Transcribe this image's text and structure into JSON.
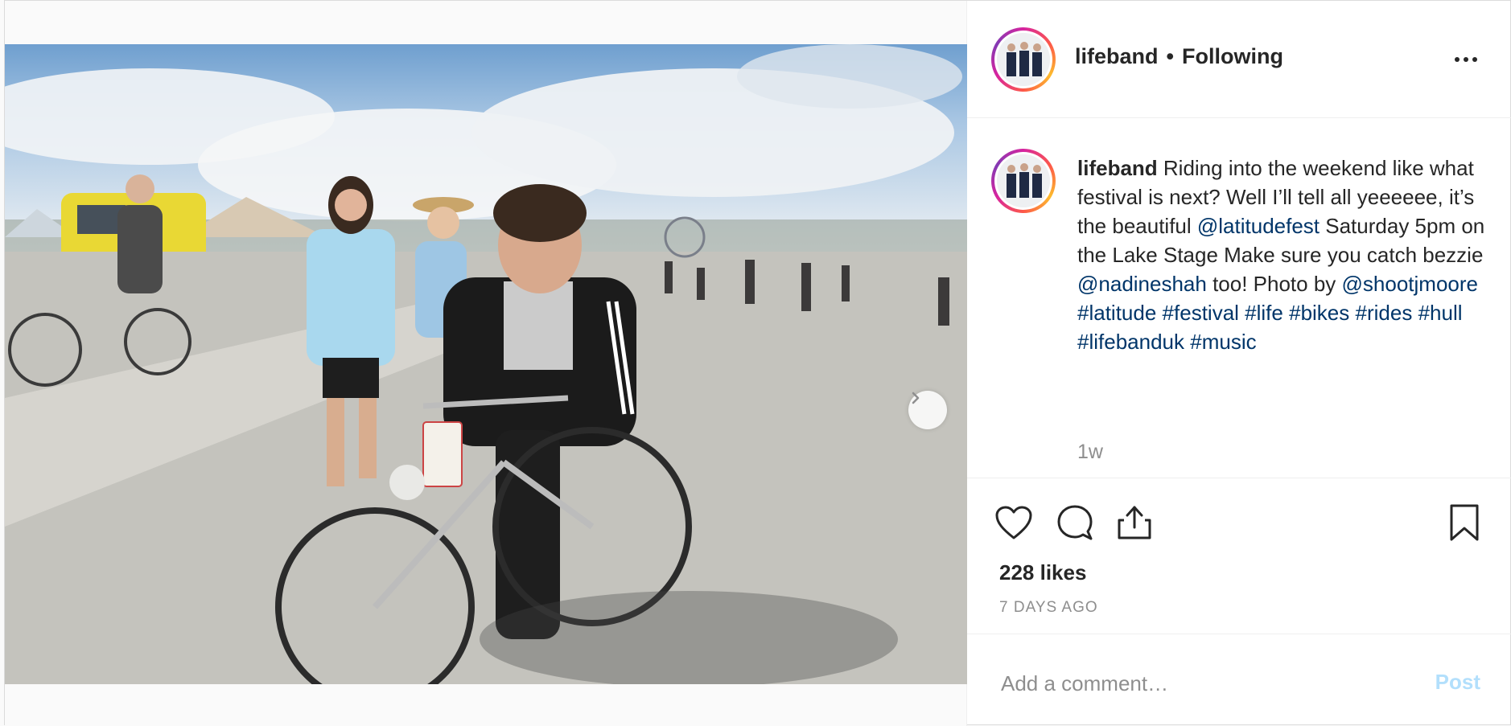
{
  "post": {
    "username": "lifeband",
    "follow_status": "Following",
    "bullet": "•",
    "more_icon": "more-horizontal-icon",
    "image": {
      "description_icon": "photo",
      "carousel_total": 2,
      "carousel_index": 1
    },
    "caption": {
      "username": "lifeband",
      "segments": [
        {
          "text": " Riding into the weekend like what festival is next? Well I’ll tell all yeeeeee, it’s the beautiful ",
          "type": "text"
        },
        {
          "text": "@latitudefest",
          "type": "link"
        },
        {
          "text": " Saturday 5pm on the Lake Stage Make sure you catch bezzie ",
          "type": "text"
        },
        {
          "text": "@nadineshah",
          "type": "link"
        },
        {
          "text": " too! Photo by ",
          "type": "text"
        },
        {
          "text": "@shootjmoore",
          "type": "link"
        },
        {
          "text": " ",
          "type": "text"
        },
        {
          "text": "#latitude",
          "type": "link"
        },
        {
          "text": " ",
          "type": "text"
        },
        {
          "text": "#festival",
          "type": "link"
        },
        {
          "text": " ",
          "type": "text"
        },
        {
          "text": "#life",
          "type": "link"
        },
        {
          "text": " ",
          "type": "text"
        },
        {
          "text": "#bikes",
          "type": "link"
        },
        {
          "text": " ",
          "type": "text"
        },
        {
          "text": "#rides",
          "type": "link"
        },
        {
          "text": " ",
          "type": "text"
        },
        {
          "text": "#hull",
          "type": "link"
        },
        {
          "text": " ",
          "type": "text"
        },
        {
          "text": "#lifebanduk",
          "type": "link"
        },
        {
          "text": " ",
          "type": "text"
        },
        {
          "text": "#music",
          "type": "link"
        }
      ],
      "time_ago": "1w"
    },
    "actions": {
      "like_icon": "heart-icon",
      "comment_icon": "comment-icon",
      "share_icon": "share-icon",
      "save_icon": "bookmark-icon"
    },
    "likes": "228 likes",
    "date": "7 DAYS AGO",
    "comment": {
      "placeholder": "Add a comment…",
      "value": "",
      "post_label": "Post"
    }
  },
  "colors": {
    "link": "#003569",
    "muted": "#8e8e8e",
    "post_button_disabled": "#b2dffc",
    "text": "#262626"
  }
}
